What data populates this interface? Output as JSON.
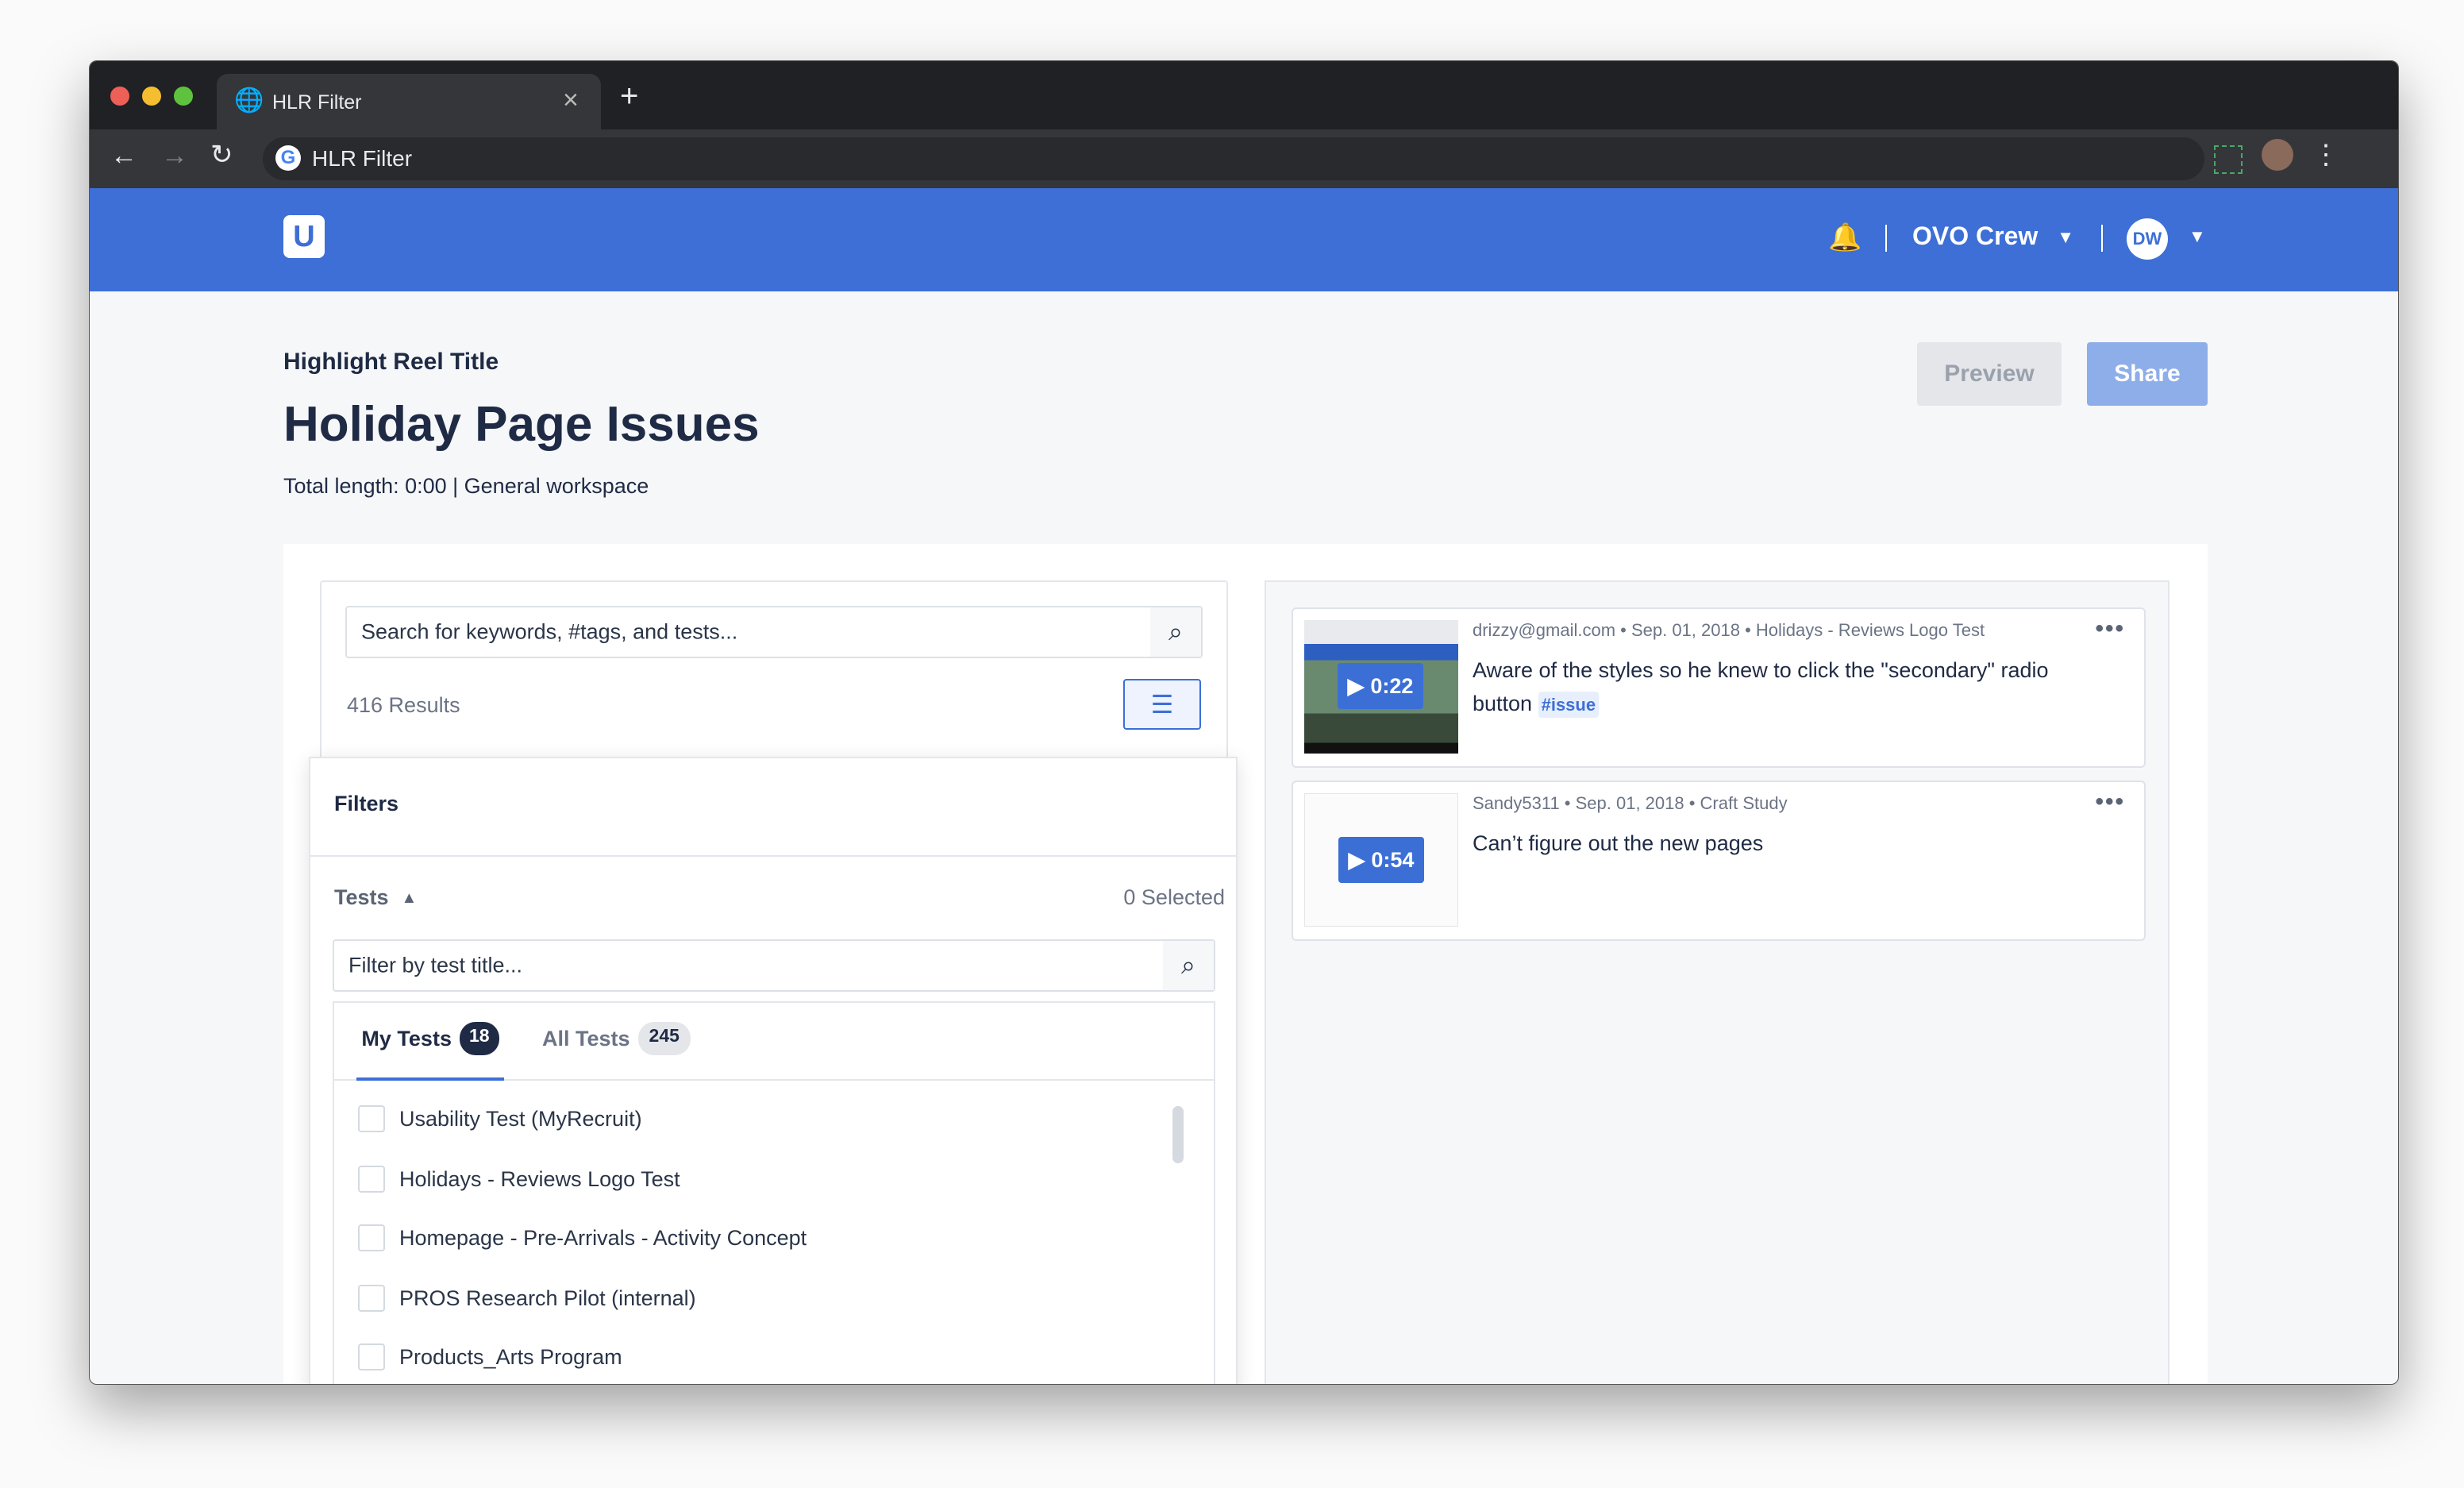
{
  "browser": {
    "tab_title": "HLR Filter",
    "address": "HLR Filter",
    "new_tab": "+",
    "close": "×",
    "menu": "⋮"
  },
  "header": {
    "logo": "U",
    "workspace": "OVO Crew",
    "avatar_initials": "DW"
  },
  "page": {
    "eyebrow": "Highlight Reel Title",
    "title": "Holiday Page Issues",
    "subtitle": "Total length: 0:00 | General workspace",
    "preview_label": "Preview",
    "share_label": "Share"
  },
  "search": {
    "placeholder": "Search for keywords, #tags, and tests...",
    "results": "416 Results"
  },
  "filters": {
    "heading": "Filters",
    "section": "Tests",
    "selected": "0 Selected",
    "filter_placeholder": "Filter by test title...",
    "tabs": [
      {
        "label": "My Tests",
        "count": "18",
        "active": true
      },
      {
        "label": "All Tests",
        "count": "245",
        "active": false
      }
    ],
    "items": [
      "Usability Test (MyRecruit)",
      "Holidays - Reviews Logo Test",
      "Homepage - Pre-Arrivals - Activity Concept",
      "PROS Research Pilot (internal)",
      "Products_Arts Program"
    ]
  },
  "clips": [
    {
      "meta": "drizzy@gmail.com • Sep. 01, 2018 • Holidays - Reviews Logo Test",
      "duration": "0:22",
      "text": "Aware of the styles so he knew to click the \"secondary\" radio button",
      "tag": "#issue"
    },
    {
      "meta": "Sandy5311 • Sep. 01, 2018 • Craft Study",
      "duration": "0:54",
      "text": "Can’t figure out the new pages",
      "tag": ""
    }
  ],
  "colors": {
    "brand": "#3d6fd6",
    "text": "#1f2a44",
    "tag_bg": "#e8effc"
  }
}
